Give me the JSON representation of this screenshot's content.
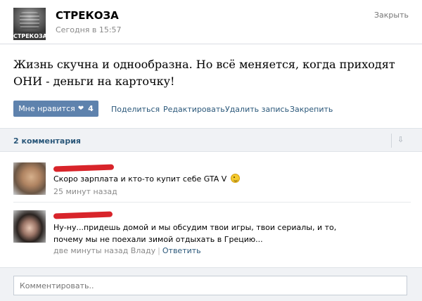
{
  "post": {
    "author": "СТРЕКОЗА",
    "avatar_logo_text": "СТРЕКОЗА",
    "time": "Сегодня в 15:57",
    "close_label": "Закрыть",
    "text": "Жизнь скучна и однообразна. Но всё меняется, когда приходят ОНИ - деньги на карточку!"
  },
  "actions": {
    "like_label": "Мне нравится",
    "like_icon": "heart-icon",
    "like_count": "4",
    "share_label": "Поделиться",
    "edit_label": "Редактировать",
    "delete_label": "Удалить запись",
    "pin_label": "Закрепить"
  },
  "comments_header": {
    "count_label": "2 комментария",
    "collapse_icon": "arrow-down-icon"
  },
  "comments": [
    {
      "text": "Скоро зарплата и кто-то купит себе GTA V",
      "emoji": "wink-smiley-icon",
      "time": "25 минут назад"
    },
    {
      "text": "Ну-ну...придешь домой и мы обсудим твои игры, твои сериалы, и то, почему мы не поехали зимой отдыхать в Грецию...",
      "time": "две минуты назад Владу",
      "reply_label": "Ответить"
    }
  ],
  "comment_input": {
    "placeholder": "Комментировать.."
  },
  "colors": {
    "like_button": "#5e82ad",
    "link": "#2b587a",
    "redaction": "#d8242a"
  }
}
